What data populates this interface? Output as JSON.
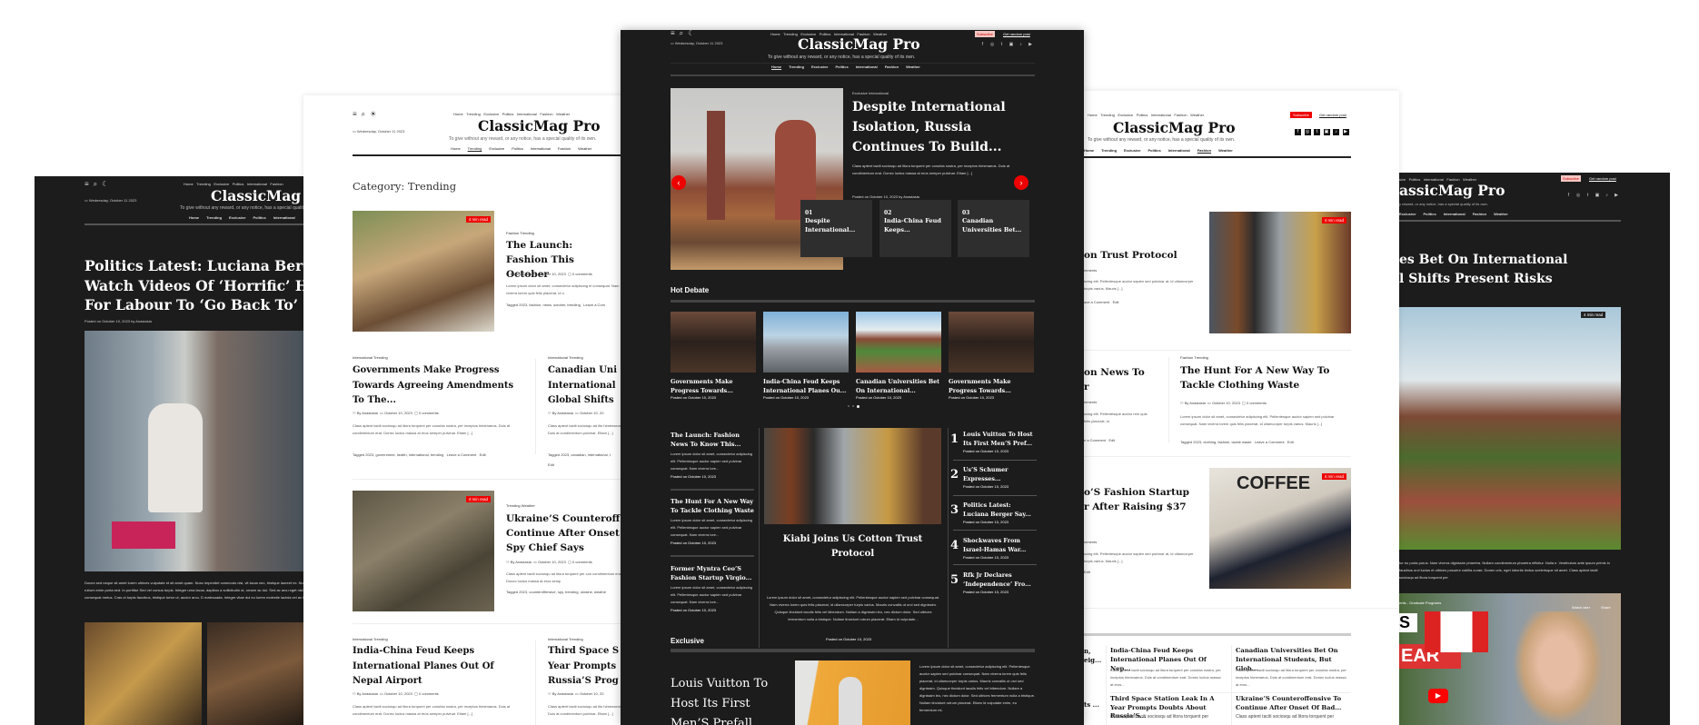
{
  "brand": {
    "title": "ClassicMag Pro",
    "title_clipped_left": "ClassicMag P",
    "title_clipped_right": "assicMag Pro",
    "tagline": "To give without any reward, or any notice, has a special quality of its own.",
    "tagline_clipped": "y reward, or any notice, has a special quality of its own.",
    "date": "Wednesday, October 11 2023"
  },
  "top_nav": [
    "Home",
    "Trending",
    "Exclusive",
    "Politics",
    "International",
    "Fashion",
    "Weather"
  ],
  "top_nav_clipped": [
    "sive",
    "Politics",
    "International",
    "Fashion",
    "Weather"
  ],
  "main_nav": [
    "Home",
    "Trending",
    "Exclusive",
    "Politics",
    "International",
    "Fashion",
    "Weather"
  ],
  "main_nav_clipped": [
    "Exclusive",
    "Politics",
    "International",
    "Fashion",
    "Weather"
  ],
  "header_actions": {
    "subscribe": "Subscribe",
    "random": "Get random post"
  },
  "social_icons": [
    "facebook-icon",
    "instagram-icon",
    "twitter-icon",
    "vk-icon",
    "tiktok-icon",
    "youtube-icon"
  ],
  "colors": {
    "accent": "#e00000",
    "dark_bg": "#1c1c1c",
    "subscribe_pink": "#f4c7c3"
  },
  "read_time": "4 min read",
  "panel_single_dark": {
    "headline_lines": [
      "Politics Latest: Luciana Berger",
      "Watch Videos Of ‘Horrific’ Ham",
      "For Labour To ‘Go Back To’ Cor"
    ],
    "posted": "Posted on October 10, 2023 by Anastasia",
    "body": "Donec sed neque sit amet lorem ultrices vulputate et sit amet quam. Nunc imperdiet commodo nisl, vit lacus nec, tristique laoreet ex. Nunc ultrices efficitur ligula, sit amet rutrum enim porta sed. In porttitor Sed vel cursus turpis. Integer urna lacus, dapibus a sollicitudin ut, ornare ac dui. Sed ac arcu eget nisi a augue vehicula at. Nullam in consequat metus. Cras ut turpis faucibus, tristique tortor ut, auctor arcu. D malesuada. Integer vitae dui eu lorem molestie lacinia vel ac libero."
  },
  "panel_category": {
    "heading": "Category: Trending",
    "posts": [
      {
        "cats": "Fashion Trending",
        "title": "The Launch: Fashion This October",
        "author": "By Anastasia",
        "date": "October 10, 2023",
        "comments": "0 comments",
        "excerpt": "Lorem ipsum dolor sit amet, consectetur adipiscing el consequat. Nam viverra lorem quis felis placerat, id u",
        "tags": "Tagged 2023, fashion, news, october, trending",
        "leave": "Leave a Com"
      },
      {
        "cats": "International Trending",
        "title": "Governments Make Progress Towards Agreeing Amendments To The...",
        "author": "By Anastasia",
        "date": "October 10, 2023",
        "comments": "0 comments",
        "excerpt": "Class aptent taciti sociosqu ad litora torquent per conubia nostra, per inceptos himenaeos. Duis at condimentum erat. Donec luctus massa at eros semper pulvinar. Etiam [...]",
        "tags": "Tagged 2023, government, health, international, trending",
        "leave": "Leave a Comment",
        "edit": "Edit"
      },
      {
        "cats": "International Trending",
        "title": "Canadian Uni International Global Shifts",
        "author": "By Anastasia",
        "date": "October 10, 20",
        "excerpt": "Class aptent taciti sociosqu ad lito himenaeos. Duis at condimentum pulvinar. Etiam [...]",
        "tags": "Tagged 2023, canadian, international, t",
        "edit": "Edit"
      },
      {
        "cats": "Trending Weather",
        "title": "Ukraine’S Counteroff Continue After Onset Spy Chief Says",
        "author": "By Anastasia",
        "date": "October 10, 2023",
        "comments": "0 comments",
        "excerpt": "Class aptent taciti sociosqu ad litora torquent per con condimentum erat. Donec luctus massa at eros semp",
        "tags": "Tagged 2023, counteroffensive, spy, trending, ukraine, weathe"
      },
      {
        "cats": "International Trending",
        "title": "India-China Feud Keeps International Planes Out Of Nepal Airport",
        "author": "By Anastasia",
        "date": "October 10, 2023",
        "comments": "0 comments",
        "excerpt": "Class aptent taciti sociosqu ad litora torquent per conubia nostra, per inceptos himenaeos. Duis at condimentum erat. Donec luctus massa at eros semper pulvinar. Etiam [...]"
      },
      {
        "cats": "International Trending",
        "title": "Third Space S Year Prompts Russia’S Prog",
        "author": "By Anastasia",
        "date": "October 10, 20",
        "excerpt": "Class aptent taciti sociosqu ad lito himenaeos. Duis at condimentum pulvinar. Etiam [...]"
      }
    ]
  },
  "panel_home": {
    "hero": {
      "cats": "Exclusive International",
      "title": "Despite International Isolation, Russia Continues To Build...",
      "excerpt": "Class aptent taciti sociosqu ad litora torquent per conubia nostra, per inceptos himenaeos. Duis at condimentum erat. Donec luctus massa at eros semper pulvinar. Etiam [...]",
      "posted": "Posted on October 10, 2023 by Anastasia"
    },
    "slider_cards": [
      {
        "num": "01",
        "title": "Despite International..."
      },
      {
        "num": "02",
        "title": "India-China Feud Keeps..."
      },
      {
        "num": "03",
        "title": "Canadian Universities Bet..."
      }
    ],
    "hot_debate": {
      "label": "Hot Debate",
      "items": [
        {
          "title": "Governments Make Progress Towards...",
          "posted": "Posted on October 10, 2023"
        },
        {
          "title": "India-China Feud Keeps International Planes Ou...",
          "posted": "Posted on October 10, 2023"
        },
        {
          "title": "Canadian Universities Bet On International...",
          "posted": "Posted on October 10, 2023"
        },
        {
          "title": "Governments Make Progress Towards...",
          "posted": "Posted on October 10, 2023"
        }
      ],
      "active_dot": 3,
      "dots": 3
    },
    "left_list": [
      {
        "title": "The Launch: Fashion News To Know This...",
        "excerpt": "Lorem ipsum dolor sit amet, consectetur adipiscing elit. Pellentesque auctor sapien sed pulvinar consequat. Nam viverra lore...",
        "posted": "Posted on October 10, 2023"
      },
      {
        "title": "The Hunt For A New Way To Tackle Clothing Waste",
        "excerpt": "Lorem ipsum dolor sit amet, consectetur adipiscing elit. Pellentesque auctor sapien sed pulvinar consequat. Nam viverra lore...",
        "posted": "Posted on October 10, 2023"
      },
      {
        "title": "Former Myntra Ceo’S Fashion Startup Virgio...",
        "excerpt": "Lorem ipsum dolor sit amet, consectetur adipiscing elit. Pellentesque auctor sapien sed pulvinar consequat. Nam viverra lore...",
        "posted": "Posted on October 10, 2023"
      }
    ],
    "feature": {
      "title": "Kiabi Joins Us Cotton Trust Protocol",
      "excerpt": "Lorem ipsum dolor sit amet, consectetur adipiscing elit. Pellentesque auctor sapien sed pulvinar consequat. Nam viverra lorem quis felis placerat, id ullamcorper turpis varius. Mauris convallis ut orci sed dignissim. Quisque tincidunt iaculis felis vel bibendum. Nullam a dignissim leo, nec dictum dolor. Sed ultrices fermentum nulla a tristique. Nullam tincidunt rutrum placerat. Etiam id vulputate...",
      "posted": "Posted on October 10, 2023"
    },
    "ranked": [
      {
        "num": "1",
        "title": "Louis Vuitton To Host Its First Men’S Pref...",
        "posted": "Posted on October 10, 2023"
      },
      {
        "num": "2",
        "title": "Us’S Schumer Expresses...",
        "posted": "Posted on October 10, 2023"
      },
      {
        "num": "3",
        "title": "Politics Latest: Luciana Berger Say...",
        "posted": "Posted on October 10, 2023"
      },
      {
        "num": "4",
        "title": "Shockwaves From Israel-Hamas War...",
        "posted": "Posted on October 10, 2023"
      },
      {
        "num": "5",
        "title": "Rfk Jr Declares ‘Independence’ Fro...",
        "posted": "Posted on October 10, 2023"
      }
    ],
    "exclusive": {
      "label": "Exclusive",
      "title": "Louis Vuitton To Host Its First Men’S Prefall",
      "excerpt": "Lorem ipsum dolor sit amet, consectetur adipiscing elit. Pellentesque auctor sapien sed pulvinar consequat. Nam viverra lorem quis felis placerat, id ullamcorper turpis varius. Mauris convallis ut orci sed dignissim. Quisque tincidunt iaculis felis vel bibendum. Nullam a dignissim leo, nec dictum dolor. Sed ultrices fermentum nulla a tristique. Nullam tincidunt rutrum placerat. Etiam id vulputate enim, eu fermentum mi."
    }
  },
  "panel_fashion": {
    "p1": {
      "title": "on Trust Protocol",
      "meta": "mments",
      "excerpt": "scing elit. Pellentesque auctor sapien sed pulvinar at, id ullamcorper turpis varius. Mauris [...]",
      "leave": "ave a Comment",
      "edit": "Edit"
    },
    "p2": {
      "title": "on News To r",
      "meta": "mments",
      "excerpt": "scing elit. Pellentesque auctor rem quis felis placerat, id",
      "leave": "e a Comment",
      "edit": "Edit"
    },
    "p3": {
      "cats": "Fashion Trending",
      "title": "The Hunt For A New Way To Tackle Clothing Waste",
      "author": "By Anastasia",
      "date": "October 10, 2023",
      "comments": "0 comments",
      "excerpt": "Lorem ipsum dolor sit amet, consectetur adipiscing elit. Pellentesque auctor sapien sed pulvinar consequat. Nam viverra lorem quis felis placerat, id ullamcorper turpis varius. Mauris [...]",
      "tags": "Tagged 2023, clothing, fashion, tackle waste",
      "leave": "Leave a Comment",
      "edit": "Edit"
    },
    "p4": {
      "title": "o’S Fashion Startup r After Raising $37",
      "meta": "mments",
      "excerpt": "scing elit. Pellentesque auctor sapien sed pulvinar at, id ullamcorper turpis varius. Mauris [...]",
      "edit": "Edit"
    },
    "grid": [
      {
        "title": "India-China Feud Keeps International Planes Out Of Nep...",
        "excerpt": "Class aptent taciti sociosqu ad litora torquent per conubia nostra, per inceptos himenaeos. Duis at condimentum erat. Donec luctus massa at eros..."
      },
      {
        "title": "Canadian Universities Bet On International Students, But Glob...",
        "excerpt": "Class aptent taciti sociosqu ad litora torquent per conubia nostra, per inceptos himenaeos. Duis at condimentum erat. Donec luctus massa at eros..."
      },
      {
        "title": "Third Space Station Leak In A Year Prompts Doubts About Russia’S...",
        "excerpt": "Class aptent taciti sociosqu ad litora torquent per"
      },
      {
        "title": "Ukraine’S Counteroffensive To Continue After Onset Of Bad...",
        "excerpt": "Class aptent taciti sociosqu ad litora torquent per"
      }
    ],
    "fragments": [
      "n,",
      "eig...",
      "ts ..."
    ]
  },
  "panel_single_dark2": {
    "headline_lines": [
      "es Bet On International",
      "l Shifts Present Risks"
    ],
    "body": "tur eu porta purus. Nam viverra dignissim pharetra. Nullam condimentum pharetra efficitur. Nulla e. Vestibulum ante ipsum primis in faucibus orci luctus et ultrices posuere cubilia curae; Donec uris, eget lobortis lectus scelerisque sit amet. Class aptent taciti sociosqu ad litora torquent per",
    "video": {
      "title": "ents - Graduate Programs",
      "watch_later": "Watch later",
      "share": "Share",
      "overlay_text_1": "S",
      "overlay_text_2": "EAR"
    }
  }
}
